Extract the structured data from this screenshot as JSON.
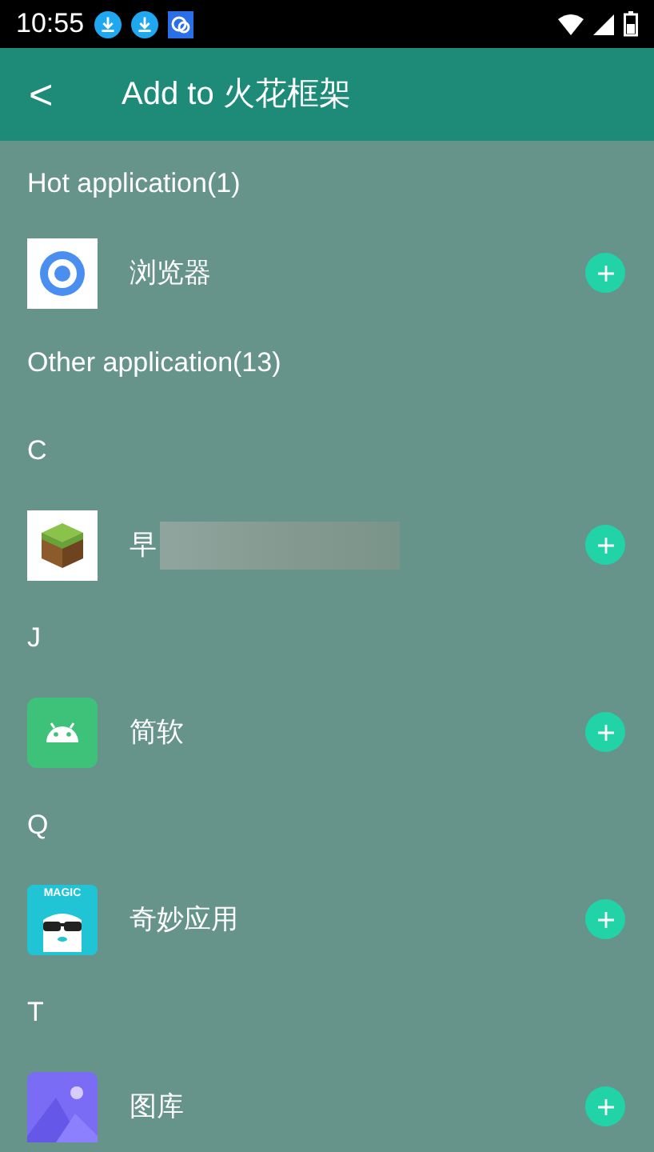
{
  "status_bar": {
    "time": "10:55"
  },
  "header": {
    "back": "<",
    "title": "Add to 火花框架"
  },
  "rows": [
    {
      "kind": "section",
      "label": "Hot application(1)"
    },
    {
      "kind": "app",
      "name": "浏览器",
      "redacted": false
    },
    {
      "kind": "section",
      "label": "Other application(13)"
    },
    {
      "kind": "letter",
      "label": "C"
    },
    {
      "kind": "app",
      "name": "早",
      "redacted": true
    },
    {
      "kind": "letter",
      "label": "J"
    },
    {
      "kind": "app",
      "name": "简软",
      "redacted": false
    },
    {
      "kind": "letter",
      "label": "Q"
    },
    {
      "kind": "app",
      "icon_text": "MAGIC",
      "name": "奇妙应用",
      "redacted": false
    },
    {
      "kind": "letter",
      "label": "T"
    },
    {
      "kind": "app",
      "name": "图库",
      "redacted": false
    }
  ]
}
